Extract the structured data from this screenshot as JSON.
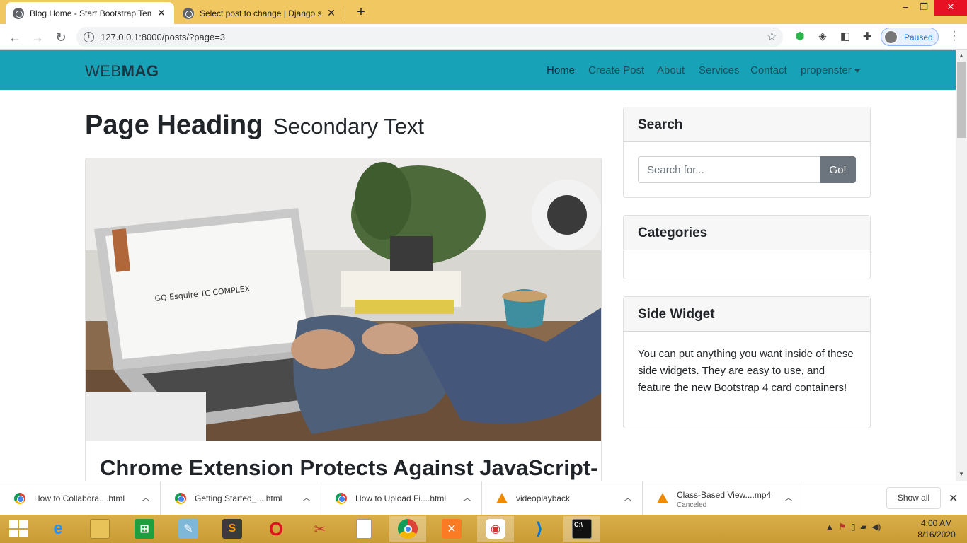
{
  "browser": {
    "tabs": [
      {
        "title": "Blog Home - Start Bootstrap Template",
        "active": true
      },
      {
        "title": "Select post to change | Django site admin",
        "active": false
      }
    ],
    "url": "127.0.0.1:8000/posts/?page=3",
    "profile_label": "Paused"
  },
  "site": {
    "brand_light": "WEB",
    "brand_bold": "MAG",
    "nav": [
      "Home",
      "Create Post",
      "About",
      "Services",
      "Contact",
      "propenster"
    ],
    "heading": "Page Heading",
    "heading_secondary": "Secondary Text",
    "post_title": "Chrome Extension Protects Against JavaScript-"
  },
  "sidebar": {
    "search_title": "Search",
    "search_placeholder": "Search for...",
    "search_button": "Go!",
    "categories_title": "Categories",
    "widget_title": "Side Widget",
    "widget_text": "You can put anything you want inside of these side widgets. They are easy to use, and feature the new Bootstrap 4 card containers!"
  },
  "downloads": {
    "items": [
      {
        "name": "How to Collabora....html",
        "type": "chrome"
      },
      {
        "name": "Getting Started_....html",
        "type": "chrome"
      },
      {
        "name": "How to Upload Fi....html",
        "type": "chrome"
      },
      {
        "name": "videoplayback",
        "type": "vlc"
      },
      {
        "name": "Class-Based View....mp4",
        "status": "Canceled",
        "type": "vlc"
      }
    ],
    "show_all": "Show all"
  },
  "taskbar": {
    "time": "4:00 AM",
    "date": "8/16/2020"
  },
  "colors": {
    "tabstrip": "#f0c761",
    "site_navbar": "#17a2b8",
    "go_button": "#6c757d"
  }
}
